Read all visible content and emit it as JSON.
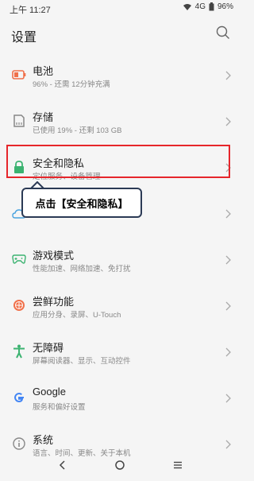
{
  "status_bar": {
    "time": "上午 11:27",
    "network": "4G",
    "battery": "96%"
  },
  "header": {
    "title": "设置"
  },
  "settings_items": [
    {
      "title": "电池",
      "subtitle": "96% - 还需 12分钟充满",
      "icon": "battery-icon",
      "color": "#f0704a"
    },
    {
      "title": "存储",
      "subtitle": "已使用 19% - 还剩 103 GB",
      "icon": "storage-icon",
      "color": "#888888"
    },
    {
      "title": "安全和隐私",
      "subtitle": "定位服务、设备管理",
      "icon": "lock-icon",
      "color": "#3cb371"
    },
    {
      "title": "",
      "subtitle": "",
      "icon": "cloud-icon",
      "color": "#4aa3df"
    },
    {
      "title": "游戏模式",
      "subtitle": "性能加速、网络加速、免打扰",
      "icon": "gamepad-icon",
      "color": "#3cb371"
    },
    {
      "title": "尝鲜功能",
      "subtitle": "应用分身、录屏、U-Touch",
      "icon": "orange-icon",
      "color": "#f0704a"
    },
    {
      "title": "无障碍",
      "subtitle": "屏幕阅读器、显示、互动控件",
      "icon": "accessibility-icon",
      "color": "#3cb371"
    },
    {
      "title": "Google",
      "subtitle": "服务和偏好设置",
      "icon": "google-icon",
      "color": "#4285f4"
    },
    {
      "title": "系统",
      "subtitle": "语言、时间、更新、关于本机",
      "icon": "info-icon",
      "color": "#888888"
    }
  ],
  "callout": {
    "text": "点击【安全和隐私】"
  },
  "nav": {
    "back": "‹",
    "home": "○",
    "menu": "≡"
  }
}
